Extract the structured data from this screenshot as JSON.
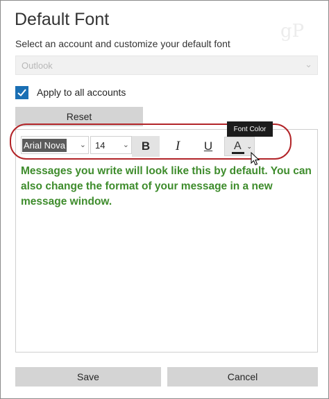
{
  "dialog": {
    "title": "Default Font",
    "watermark": "gP",
    "subtitle": "Select an account and customize your default font"
  },
  "account": {
    "selected": "Outlook",
    "chevron": "⌄"
  },
  "apply_all": {
    "label": "Apply to all accounts",
    "checked": true
  },
  "reset_label": "Reset",
  "toolbar": {
    "font_name": "Arial Nova",
    "font_size": "14",
    "bold_label": "B",
    "italic_label": "I",
    "underline_label": "U",
    "color_label": "A",
    "chevron": "⌄",
    "tooltip": "Font Color"
  },
  "editor": {
    "preview_text": "Messages you write will look like this by default. You can also change the format of your message in a new message window.",
    "text_color": "#3e8c2c"
  },
  "footer": {
    "save_label": "Save",
    "cancel_label": "Cancel"
  },
  "colors": {
    "accent": "#1a6fb4",
    "highlight": "#b22428"
  }
}
